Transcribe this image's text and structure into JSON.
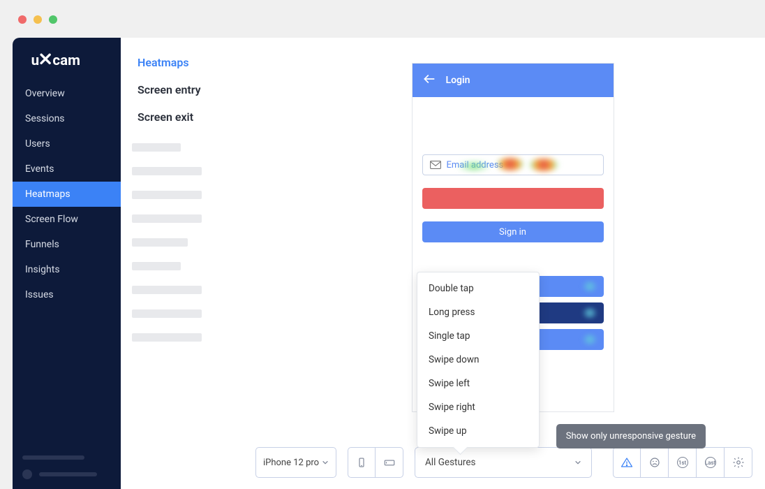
{
  "brand": "uxcam",
  "sidebar": {
    "items": [
      {
        "label": "Overview"
      },
      {
        "label": "Sessions"
      },
      {
        "label": "Users"
      },
      {
        "label": "Events"
      },
      {
        "label": "Heatmaps",
        "active": true
      },
      {
        "label": "Screen Flow"
      },
      {
        "label": "Funnels"
      },
      {
        "label": "Insights"
      },
      {
        "label": "Issues"
      }
    ]
  },
  "subnav": {
    "items": [
      {
        "label": "Heatmaps",
        "active": true
      },
      {
        "label": "Screen entry"
      },
      {
        "label": "Screen exit"
      }
    ]
  },
  "phone": {
    "title": "Login",
    "email_placeholder": "Email address",
    "signin_label": "Sign in"
  },
  "gesture_dropdown": {
    "options": [
      "Double tap",
      "Long press",
      "Single tap",
      "Swipe down",
      "Swipe left",
      "Swipe right",
      "Swipe up"
    ]
  },
  "toolbar": {
    "device": "iPhone 12 pro",
    "gesture_filter": "All Gestures"
  },
  "tooltip": {
    "unresponsive": "Show only unresponsive gesture"
  },
  "colors": {
    "accent": "#3b82f6",
    "sidebar_bg": "#0d1a3a"
  }
}
